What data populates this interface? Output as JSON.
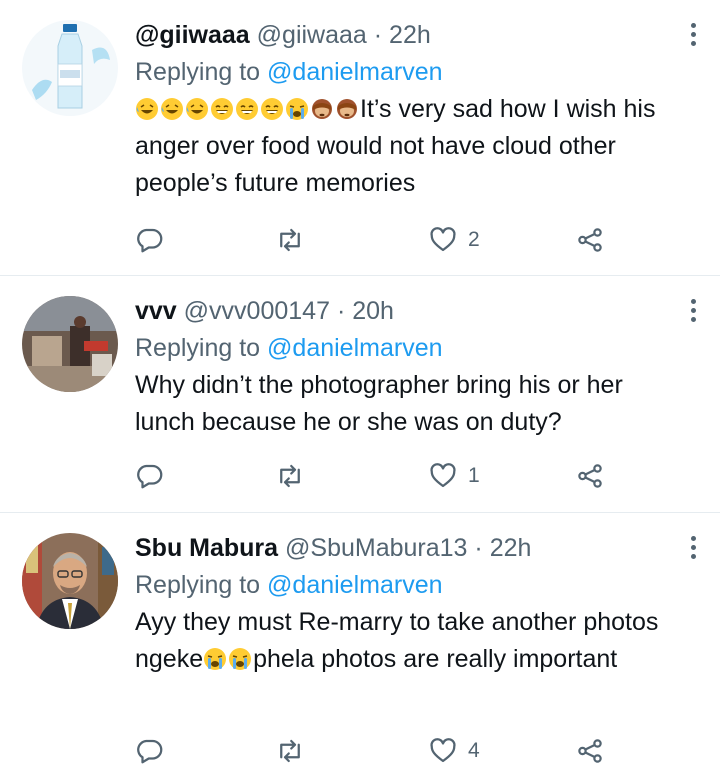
{
  "colors": {
    "text": "#0f1419",
    "secondary": "#536471",
    "link": "#1d9bf0",
    "divider": "#e6ecf0"
  },
  "icons": [
    "reply-icon",
    "retweet-icon",
    "like-icon",
    "share-icon",
    "more-icon"
  ],
  "tweets": [
    {
      "display_name": "@giiwaaa",
      "handle": "@giiwaaa",
      "separator": "·",
      "time": "22h",
      "replying_prefix": "Replying to",
      "replying_to": "@danielmarven",
      "text_after_emoji": "It’s very sad how I wish his anger over food would not have cloud other people’s future memories",
      "likes": "2"
    },
    {
      "display_name": "vvv",
      "handle": "@vvv000147",
      "separator": "·",
      "time": "20h",
      "replying_prefix": "Replying to",
      "replying_to": "@danielmarven",
      "text": "Why didn’t the photographer bring his or her lunch because he or she was on duty?",
      "likes": "1"
    },
    {
      "display_name": "Sbu Mabura",
      "handle": "@SbuMabura13",
      "separator": "·",
      "time": "22h",
      "replying_prefix": "Replying to",
      "replying_to": "@danielmarven",
      "text_part1": "Ayy they must Re-marry to take another photos ngeke",
      "text_part2": "phela photos are really important",
      "likes": "4"
    }
  ]
}
